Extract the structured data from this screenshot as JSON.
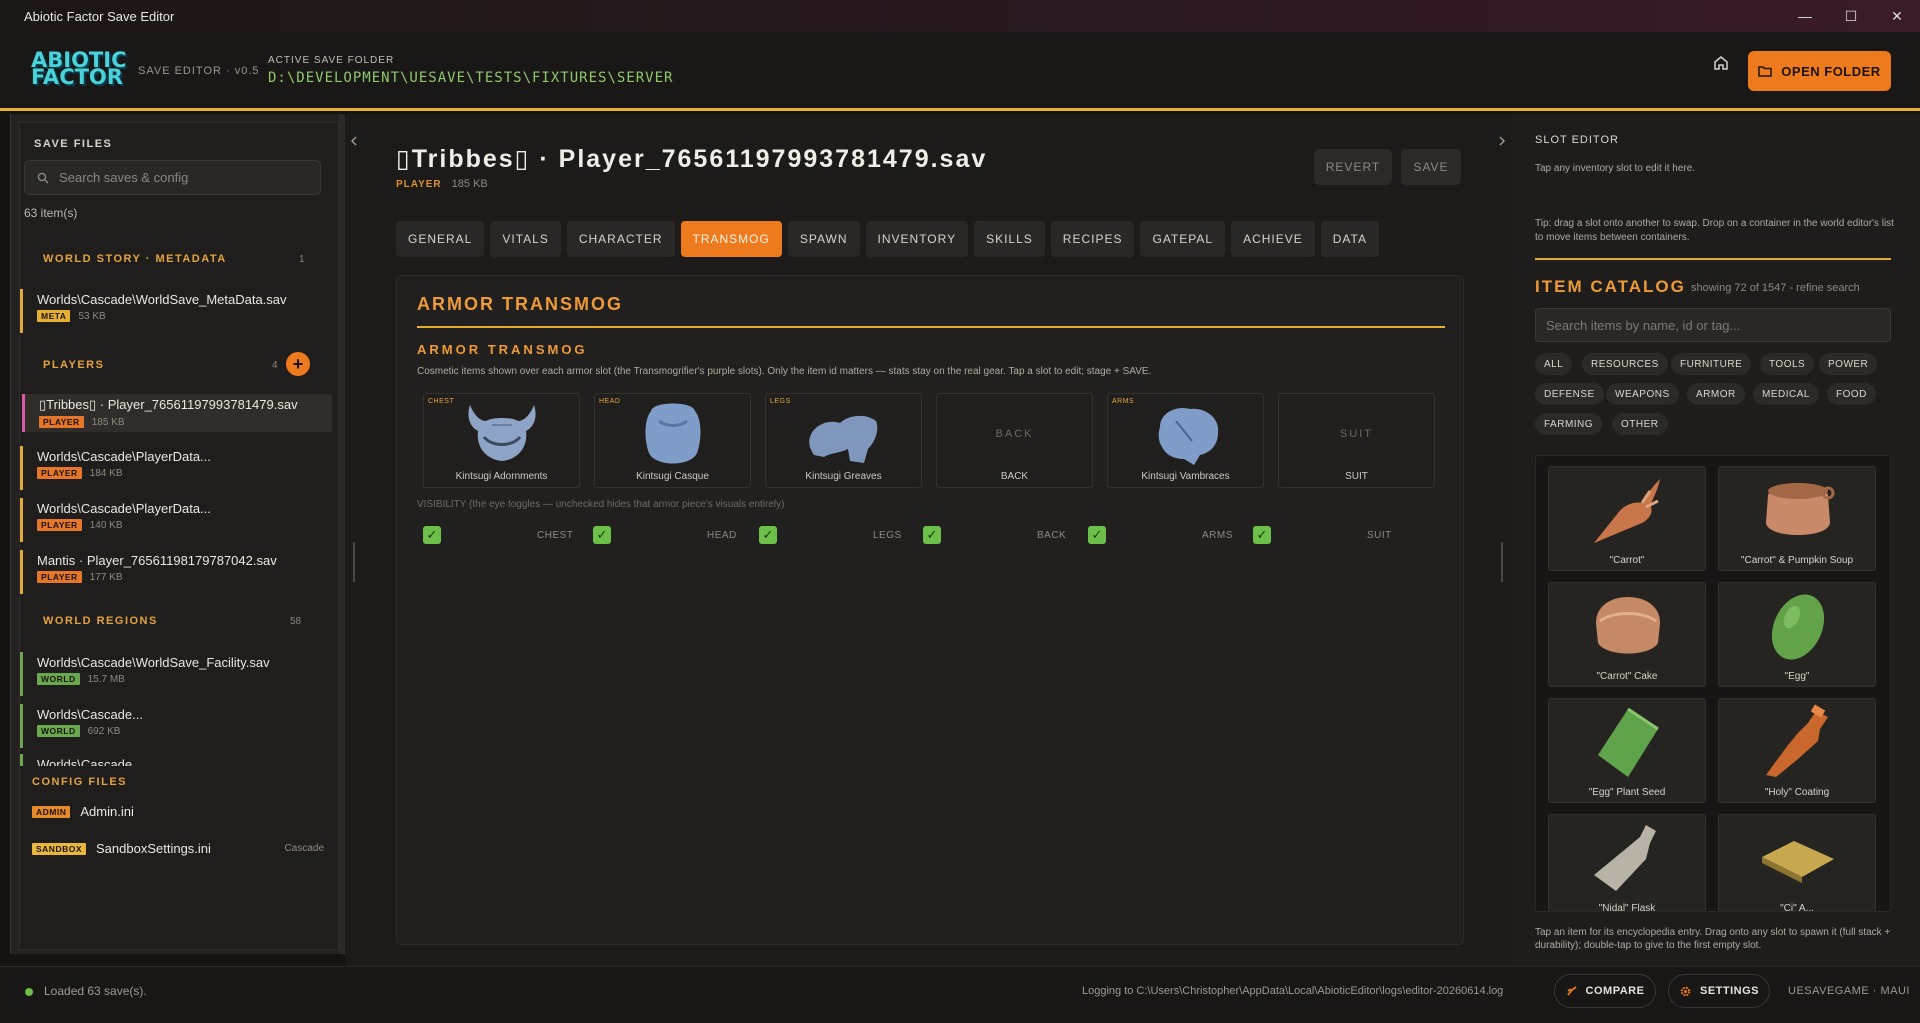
{
  "window": {
    "title": "Abiotic Factor Save Editor",
    "min": "—",
    "max": "☐",
    "close": "✕"
  },
  "header": {
    "logo_line1": "ABIOTIC",
    "logo_line2": "FACTOR",
    "version": "SAVE EDITOR · v0.5",
    "active_label": "ACTIVE SAVE FOLDER",
    "active_path": "D:\\DEVELOPMENT\\UESAVE\\TESTS\\FIXTURES\\SERVER",
    "open_folder": "OPEN FOLDER"
  },
  "sidebar": {
    "title": "SAVE FILES",
    "search_placeholder": "Search saves & config",
    "count": "63 item(s)",
    "world_story": {
      "title": "WORLD STORY · METADATA",
      "count": "1",
      "items": [
        {
          "name": "Worlds\\Cascade\\WorldSave_MetaData.sav",
          "badge": "META",
          "size": "53 KB"
        }
      ]
    },
    "players": {
      "title": "PLAYERS",
      "count": "4",
      "add": "+",
      "items": [
        {
          "name": "▯Tribbes▯ · Player_76561197993781479.sav",
          "badge": "PLAYER",
          "size": "185 KB"
        },
        {
          "name": "Worlds\\Cascade\\PlayerData...",
          "badge": "PLAYER",
          "size": "184 KB"
        },
        {
          "name": "Worlds\\Cascade\\PlayerData...",
          "badge": "PLAYER",
          "size": "140 KB"
        },
        {
          "name": "Mantis · Player_76561198179787042.sav",
          "badge": "PLAYER",
          "size": "177 KB"
        }
      ]
    },
    "regions": {
      "title": "WORLD REGIONS",
      "count": "58",
      "items": [
        {
          "name": "Worlds\\Cascade\\WorldSave_Facility.sav",
          "badge": "WORLD",
          "size": "15.7 MB"
        },
        {
          "name": "Worlds\\Cascade...",
          "badge": "WORLD",
          "size": "692 KB"
        },
        {
          "name": "Worlds\\Cascade...",
          "badge": "",
          "size": ""
        }
      ]
    },
    "config": {
      "title": "CONFIG FILES",
      "items": [
        {
          "name": "Admin.ini",
          "badge": "ADMIN",
          "tag": ""
        },
        {
          "name": "SandboxSettings.ini",
          "badge": "SANDBOX",
          "tag": "Cascade"
        }
      ]
    }
  },
  "main": {
    "title": "▯Tribbes▯ · Player_76561197993781479.sav",
    "kind": "PLAYER",
    "size": "185 KB",
    "revert": "REVERT",
    "save": "SAVE",
    "tabs": [
      "GENERAL",
      "VITALS",
      "CHARACTER",
      "TRANSMOG",
      "SPAWN",
      "INVENTORY",
      "SKILLS",
      "RECIPES",
      "GATEPAL",
      "ACHIEVE",
      "DATA"
    ],
    "active_tab": "TRANSMOG",
    "section_title": "ARMOR TRANSMOG",
    "sub_title": "ARMOR TRANSMOG",
    "description": "Cosmetic items shown over each armor slot (the Transmogrifier's purple slots). Only the item id matters — stats stay on the real gear. Tap a slot to edit; stage + SAVE.",
    "slots": [
      {
        "label": "CHEST",
        "item": "Kintsugi Adornments",
        "empty": ""
      },
      {
        "label": "HEAD",
        "item": "Kintsugi Casque",
        "empty": ""
      },
      {
        "label": "LEGS",
        "item": "Kintsugi Greaves",
        "empty": ""
      },
      {
        "label": "",
        "item": "BACK",
        "empty": "BACK"
      },
      {
        "label": "ARMS",
        "item": "Kintsugi Vambraces",
        "empty": ""
      },
      {
        "label": "",
        "item": "SUIT",
        "empty": "SUIT"
      }
    ],
    "visibility_label": "VISIBILITY (the eye toggles — unchecked hides that armor piece's visuals entirely)",
    "visibility": [
      "CHEST",
      "HEAD",
      "LEGS",
      "BACK",
      "ARMS",
      "SUIT"
    ],
    "check": "✓"
  },
  "right": {
    "slot_title": "SLOT EDITOR",
    "slot_hint": "Tap any inventory slot to edit it here.",
    "tip": "Tip: drag a slot onto another to swap. Drop on a container in the world editor's list to move items between containers.",
    "catalog_title": "ITEM CATALOG",
    "catalog_count": "showing 72 of 1547 - refine search",
    "search_placeholder": "Search items by name, id or tag...",
    "chips": [
      "ALL",
      "RESOURCES",
      "FURNITURE",
      "TOOLS",
      "POWER",
      "DEFENSE",
      "WEAPONS",
      "ARMOR",
      "MEDICAL",
      "FOOD",
      "FARMING",
      "OTHER"
    ],
    "items": [
      "\"Carrot\"",
      "\"Carrot\" & Pumpkin Soup",
      "\"Carrot\" Cake",
      "\"Egg\"",
      "\"Egg\" Plant Seed",
      "\"Holy\" Coating",
      "\"Nidal\" Flask",
      "\"Ci\" A..."
    ],
    "footer": "Tap an item for its encyclopedia entry. Drag onto any slot to spawn it (full stack + durability); double-tap to give to the first empty slot."
  },
  "status": {
    "loaded": "Loaded 63 save(s).",
    "log": "Logging to C:\\Users\\Christopher\\AppData\\Local\\AbioticEditor\\logs\\editor-20260614.log",
    "compare": "COMPARE",
    "settings": "SETTINGS",
    "brand": "UESAVEGAME · MAUI"
  },
  "colors": {
    "accent": "#ee7a1e",
    "gold": "#e3ac2e",
    "ok": "#6cc04a",
    "logo": "#49d3d8"
  }
}
